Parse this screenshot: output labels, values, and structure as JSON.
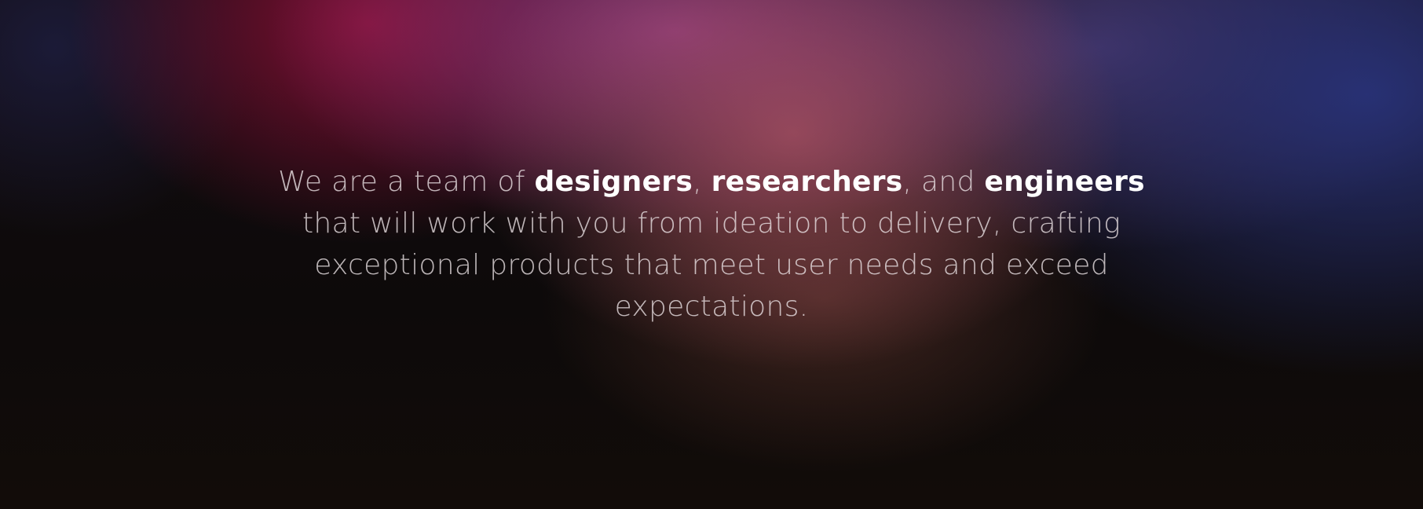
{
  "hero": {
    "intro": "We are a team of ",
    "term1": "designers",
    "sep1": ", ",
    "term2": "researchers",
    "sep2": ", and ",
    "term3": "engineers",
    "rest": " that will work with you from ideation to delivery, crafting exceptional products that meet user needs and exceed expectations."
  },
  "colors": {
    "text": "#e8e0e2",
    "emphasis": "#ffffff",
    "background_dark": "#0b0909",
    "glow_magenta": "#8c0f37",
    "glow_purple": "#963c87",
    "glow_rose": "#af5564",
    "glow_blue": "#283278"
  }
}
